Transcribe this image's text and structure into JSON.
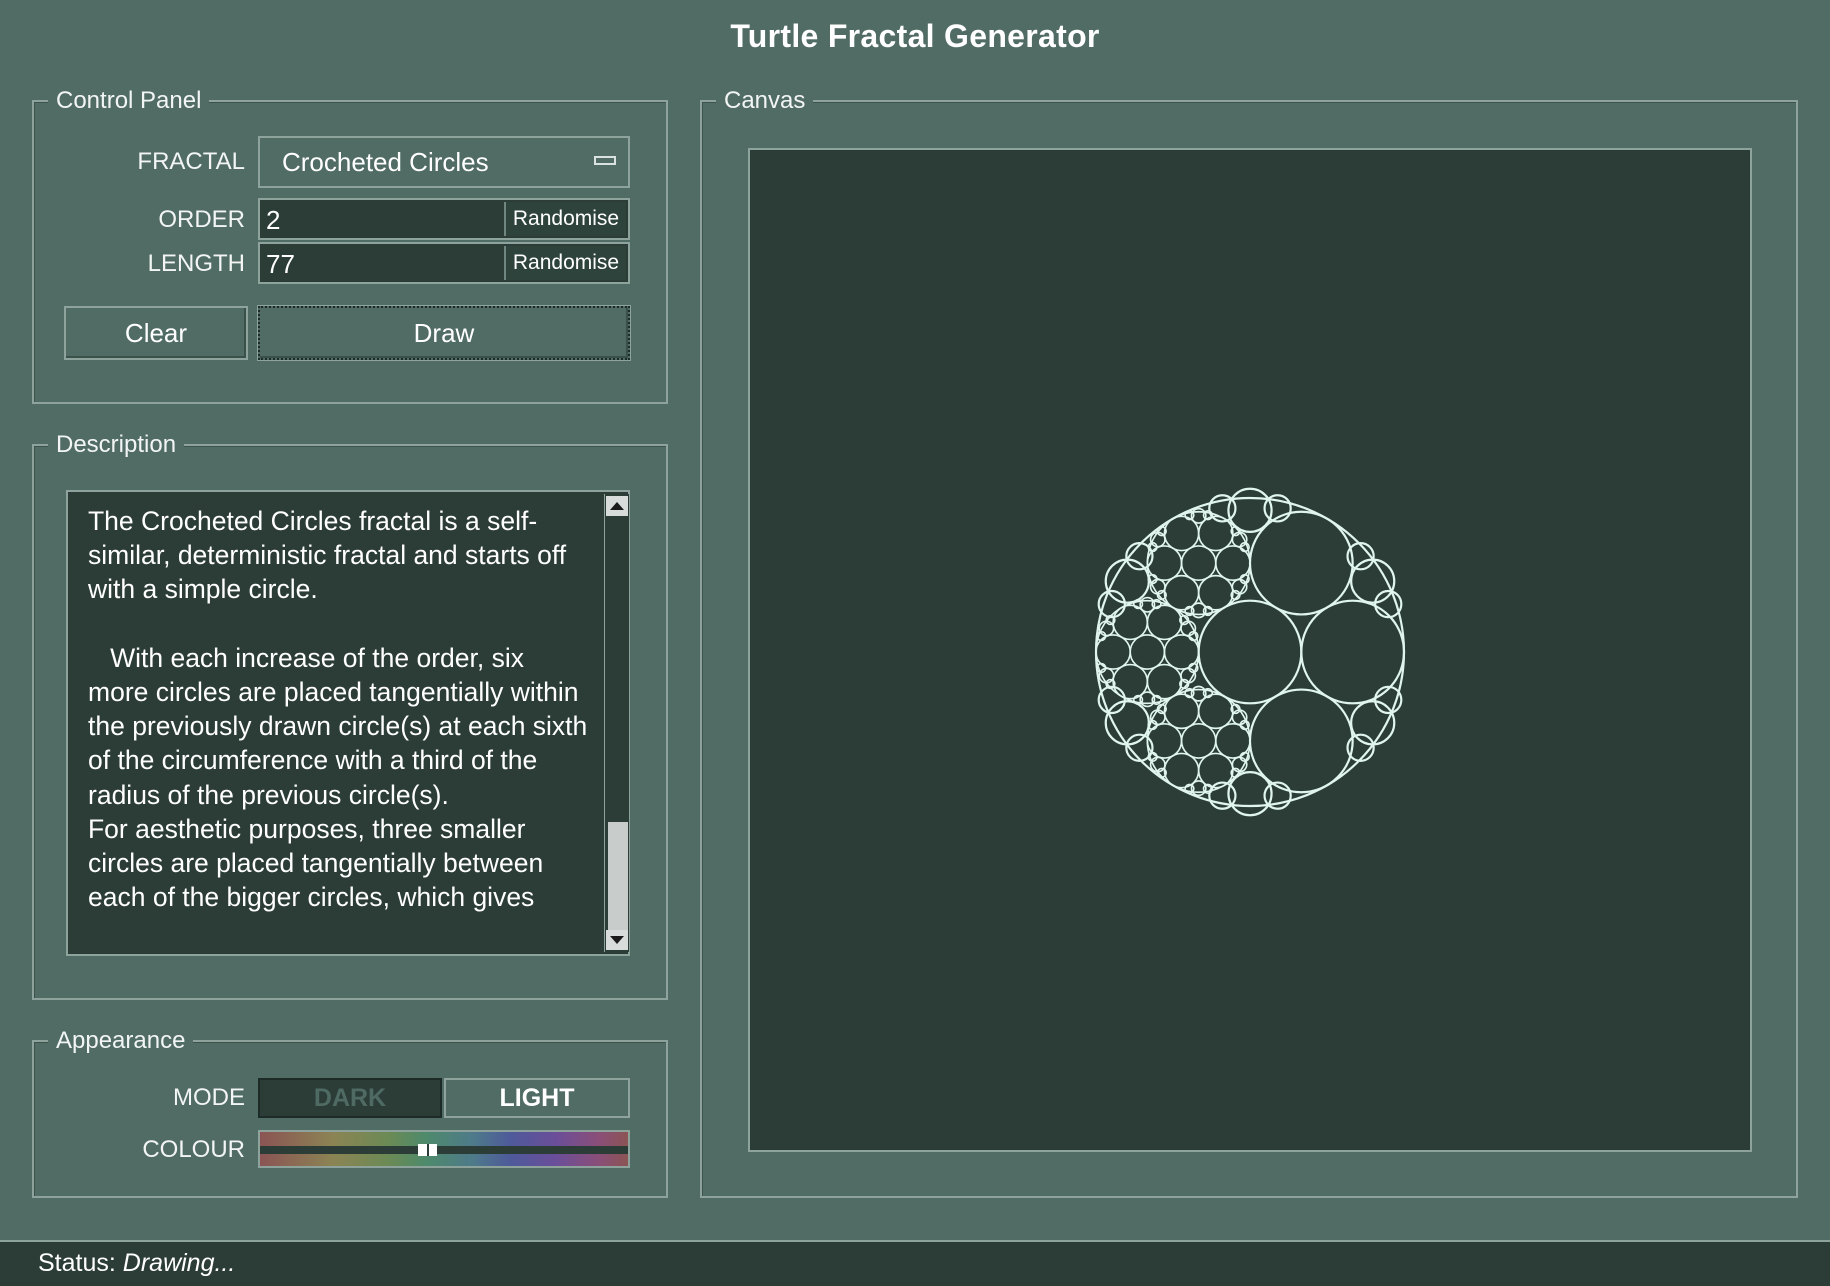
{
  "window": {
    "title": "Turtle Fractal Generator"
  },
  "control_panel": {
    "legend": "Control Panel",
    "fractal_label": "FRACTAL",
    "fractal_value": "Crocheted Circles",
    "order_label": "ORDER",
    "order_value": "2",
    "length_label": "LENGTH",
    "length_value": "77",
    "randomise_label": "Randomise",
    "clear_label": "Clear",
    "draw_label": "Draw"
  },
  "description": {
    "legend": "Description",
    "text": "The Crocheted Circles fractal is a self-similar, deterministic fractal and starts off with a simple circle.\n\n   With each increase of the order, six more circles are placed tangentially within the previously drawn circle(s) at each sixth of the circumference with a third of the radius of the previous circle(s).\nFor aesthetic purposes, three smaller circles are placed tangentially between each of the bigger circles, which gives"
  },
  "appearance": {
    "legend": "Appearance",
    "mode_label": "MODE",
    "dark_label": "DARK",
    "light_label": "LIGHT",
    "colour_label": "COLOUR"
  },
  "canvas": {
    "legend": "Canvas",
    "stroke_color": "#dff5ee",
    "background": "#2c3d38"
  },
  "status": {
    "label": "Status:",
    "value": "Drawing..."
  }
}
